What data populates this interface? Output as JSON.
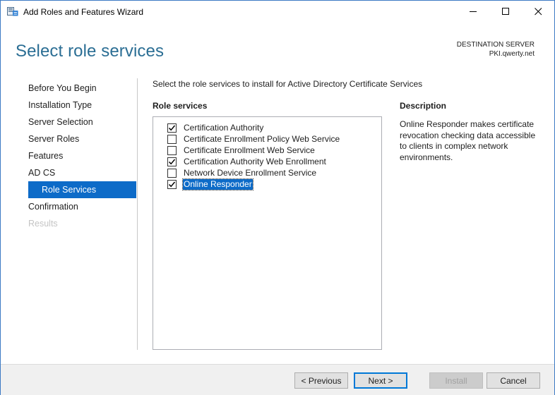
{
  "window": {
    "title": "Add Roles and Features Wizard",
    "icons": {
      "app": "server-manager-icon",
      "minimize": "minimize-icon",
      "maximize": "maximize-icon",
      "close": "close-icon"
    }
  },
  "header": {
    "page_title": "Select role services",
    "destination_label": "DESTINATION SERVER",
    "destination_server": "PKI.qwerty.net"
  },
  "nav": {
    "items": [
      {
        "label": "Before You Begin",
        "state": "normal"
      },
      {
        "label": "Installation Type",
        "state": "normal"
      },
      {
        "label": "Server Selection",
        "state": "normal"
      },
      {
        "label": "Server Roles",
        "state": "normal"
      },
      {
        "label": "Features",
        "state": "normal"
      },
      {
        "label": "AD CS",
        "state": "normal"
      },
      {
        "label": "Role Services",
        "state": "selected"
      },
      {
        "label": "Confirmation",
        "state": "normal"
      },
      {
        "label": "Results",
        "state": "disabled"
      }
    ]
  },
  "main": {
    "instruction": "Select the role services to install for Active Directory Certificate Services",
    "role_services_heading": "Role services",
    "role_services": [
      {
        "label": "Certification Authority",
        "checked": true,
        "selected": false
      },
      {
        "label": "Certificate Enrollment Policy Web Service",
        "checked": false,
        "selected": false
      },
      {
        "label": "Certificate Enrollment Web Service",
        "checked": false,
        "selected": false
      },
      {
        "label": "Certification Authority Web Enrollment",
        "checked": true,
        "selected": false
      },
      {
        "label": "Network Device Enrollment Service",
        "checked": false,
        "selected": false
      },
      {
        "label": "Online Responder",
        "checked": true,
        "selected": true
      }
    ],
    "description_heading": "Description",
    "description_text": "Online Responder makes certificate revocation checking data accessible to clients in complex network environments."
  },
  "footer": {
    "previous_label": "< Previous",
    "next_label": "Next >",
    "install_label": "Install",
    "install_enabled": false,
    "cancel_label": "Cancel"
  },
  "colors": {
    "title_accent": "#2b6e94",
    "selection": "#0d6bc8",
    "window_border": "#3c7ac4",
    "footer_bg": "#f0f0f0"
  }
}
